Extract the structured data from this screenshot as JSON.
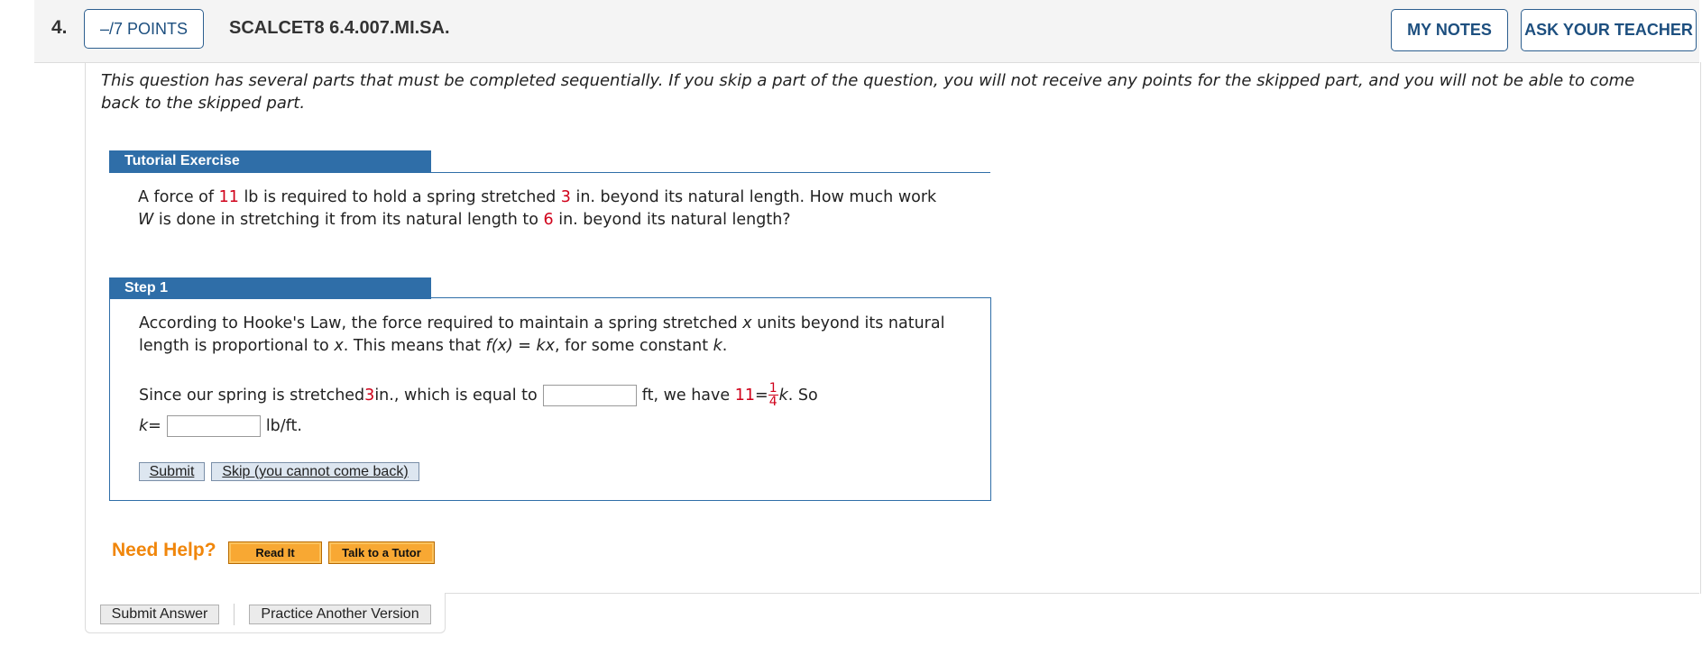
{
  "header": {
    "question_number": "4.",
    "points_label": "–/7 POINTS",
    "question_code": "SCALCET8 6.4.007.MI.SA.",
    "my_notes_label": "MY NOTES",
    "ask_teacher_label": "ASK YOUR TEACHER"
  },
  "intro": "This question has several parts that must be completed sequentially. If you skip a part of the question, you will not receive any points for the skipped part, and you will not be able to come back to the skipped part.",
  "tutorial": {
    "title": "Tutorial Exercise",
    "problem": {
      "p1": "A force of ",
      "force": "11",
      "p2": " lb is required to hold a spring stretched ",
      "stretch": "3",
      "p3": " in. beyond its natural length. How much work ",
      "var_w": "W",
      "p4": " is done in stretching it from its natural length to ",
      "length": "6",
      "p5": " in. beyond its natural length?"
    }
  },
  "step1": {
    "title": "Step 1",
    "text": {
      "a": "According to Hooke's Law, the force required to maintain a spring stretched ",
      "x1": "x",
      "b": " units beyond its natural length is proportional to ",
      "x2": "x",
      "c": ". This means that ",
      "fx": "f(x)",
      "d": " = ",
      "kx": "kx",
      "e": ", for some constant ",
      "k": "k",
      "f": "."
    },
    "since": {
      "a": "Since our spring is stretched ",
      "stretch": "3",
      "b": " in., which is equal to",
      "c": "ft, we have ",
      "force": "11",
      "eq": " = ",
      "frac_num": "1",
      "frac_den": "4",
      "k": "k",
      "d": ".  So"
    },
    "k_line": {
      "k": "k",
      "eq": " = ",
      "unit": "lb/ft."
    },
    "input1_value": "",
    "input2_value": "",
    "submit_label": "Submit",
    "skip_label": "Skip (you cannot come back)"
  },
  "help": {
    "label": "Need Help?",
    "read_it": "Read It",
    "tutor": "Talk to a Tutor"
  },
  "footer": {
    "submit_answer": "Submit Answer",
    "practice": "Practice Another Version"
  },
  "colors": {
    "accent_blue": "#2f6ea8",
    "value_red": "#d0021b",
    "help_orange": "#f0860b"
  }
}
